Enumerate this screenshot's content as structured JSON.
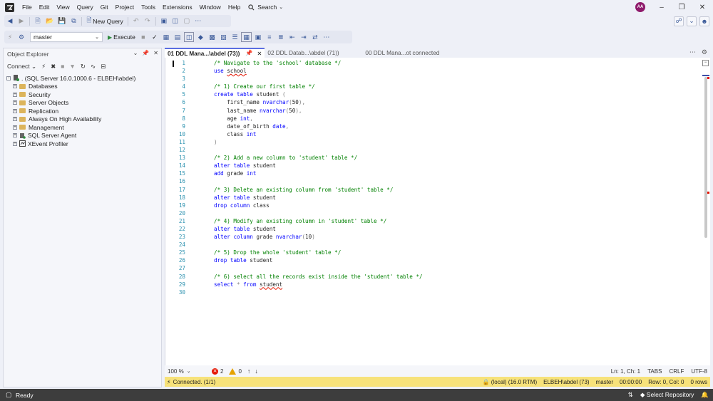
{
  "menu": {
    "items": [
      "File",
      "Edit",
      "View",
      "Query",
      "Git",
      "Project",
      "Tools",
      "Extensions",
      "Window",
      "Help"
    ],
    "search_label": "Search",
    "avatar_initials": "AA"
  },
  "toolbar": {
    "new_query_label": "New Query",
    "database_selected": "master",
    "execute_label": "Execute"
  },
  "object_explorer": {
    "title": "Object Explorer",
    "connect_label": "Connect",
    "server_node": ". (SQL Server 16.0.1000.6 - ELBEH\\abdel)",
    "children": [
      {
        "label": "Databases",
        "icon": "folder-icon"
      },
      {
        "label": "Security",
        "icon": "folder-icon"
      },
      {
        "label": "Server Objects",
        "icon": "folder-icon"
      },
      {
        "label": "Replication",
        "icon": "folder-icon"
      },
      {
        "label": "Always On High Availability",
        "icon": "folder-icon"
      },
      {
        "label": "Management",
        "icon": "folder-icon"
      },
      {
        "label": "SQL Server Agent",
        "icon": "agent-icon"
      },
      {
        "label": "XEvent Profiler",
        "icon": "profiler-icon"
      }
    ]
  },
  "editor": {
    "tabs": [
      {
        "label": "01 DDL Mana...\\abdel (73))",
        "active": true
      },
      {
        "label": "02 DDL Datab...\\abdel (71))",
        "active": false
      },
      {
        "label": "00 DDL Mana...ot connected",
        "active": false
      }
    ],
    "lines": [
      "/* Navigate to the 'school' database */",
      "use school",
      "",
      "/* 1) Create our first table */",
      "create table student (",
      "    first_name nvarchar(50),",
      "    last_name nvarchar(50),",
      "    age int,",
      "    date_of_birth date,",
      "    class int",
      ")",
      "",
      "/* 2) Add a new column to 'student' table */",
      "alter table student",
      "add grade int",
      "",
      "/* 3) Delete an existing column from 'student' table */",
      "alter table student",
      "drop column class",
      "",
      "/* 4) Modify an existing column in 'student' table */",
      "alter table student",
      "alter column grade nvarchar(10)",
      "",
      "/* 5) Drop the whole 'student' table */",
      "drop table student",
      "",
      "/* 6) select all the records exist inside the 'student' table */",
      "select * from student",
      ""
    ],
    "line_numbers": [
      "1",
      "2",
      "3",
      "4",
      "5",
      "6",
      "7",
      "8",
      "9",
      "10",
      "11",
      "12",
      "13",
      "14",
      "15",
      "16",
      "17",
      "18",
      "19",
      "20",
      "21",
      "22",
      "23",
      "24",
      "25",
      "26",
      "27",
      "28",
      "29",
      "30"
    ]
  },
  "editor_status": {
    "zoom": "100 %",
    "errors": "2",
    "warnings": "0",
    "position": "Ln: 1, Ch: 1",
    "indent": "TABS",
    "line_ending": "CRLF",
    "encoding": "UTF-8"
  },
  "query_status": {
    "connection": "Connected. (1/1)",
    "server": "(local) (16.0 RTM)",
    "user": "ELBEH\\abdel (73)",
    "database": "master",
    "elapsed": "00:00:00",
    "row_col": "Row: 0, Col: 0",
    "rows": "0 rows"
  },
  "statusbar": {
    "ready": "Ready",
    "select_repo": "Select Repository"
  },
  "colors": {
    "comment": "#008000",
    "keyword": "#0000ff",
    "query_status_bg": "#f7e27a",
    "error": "#e51400"
  }
}
